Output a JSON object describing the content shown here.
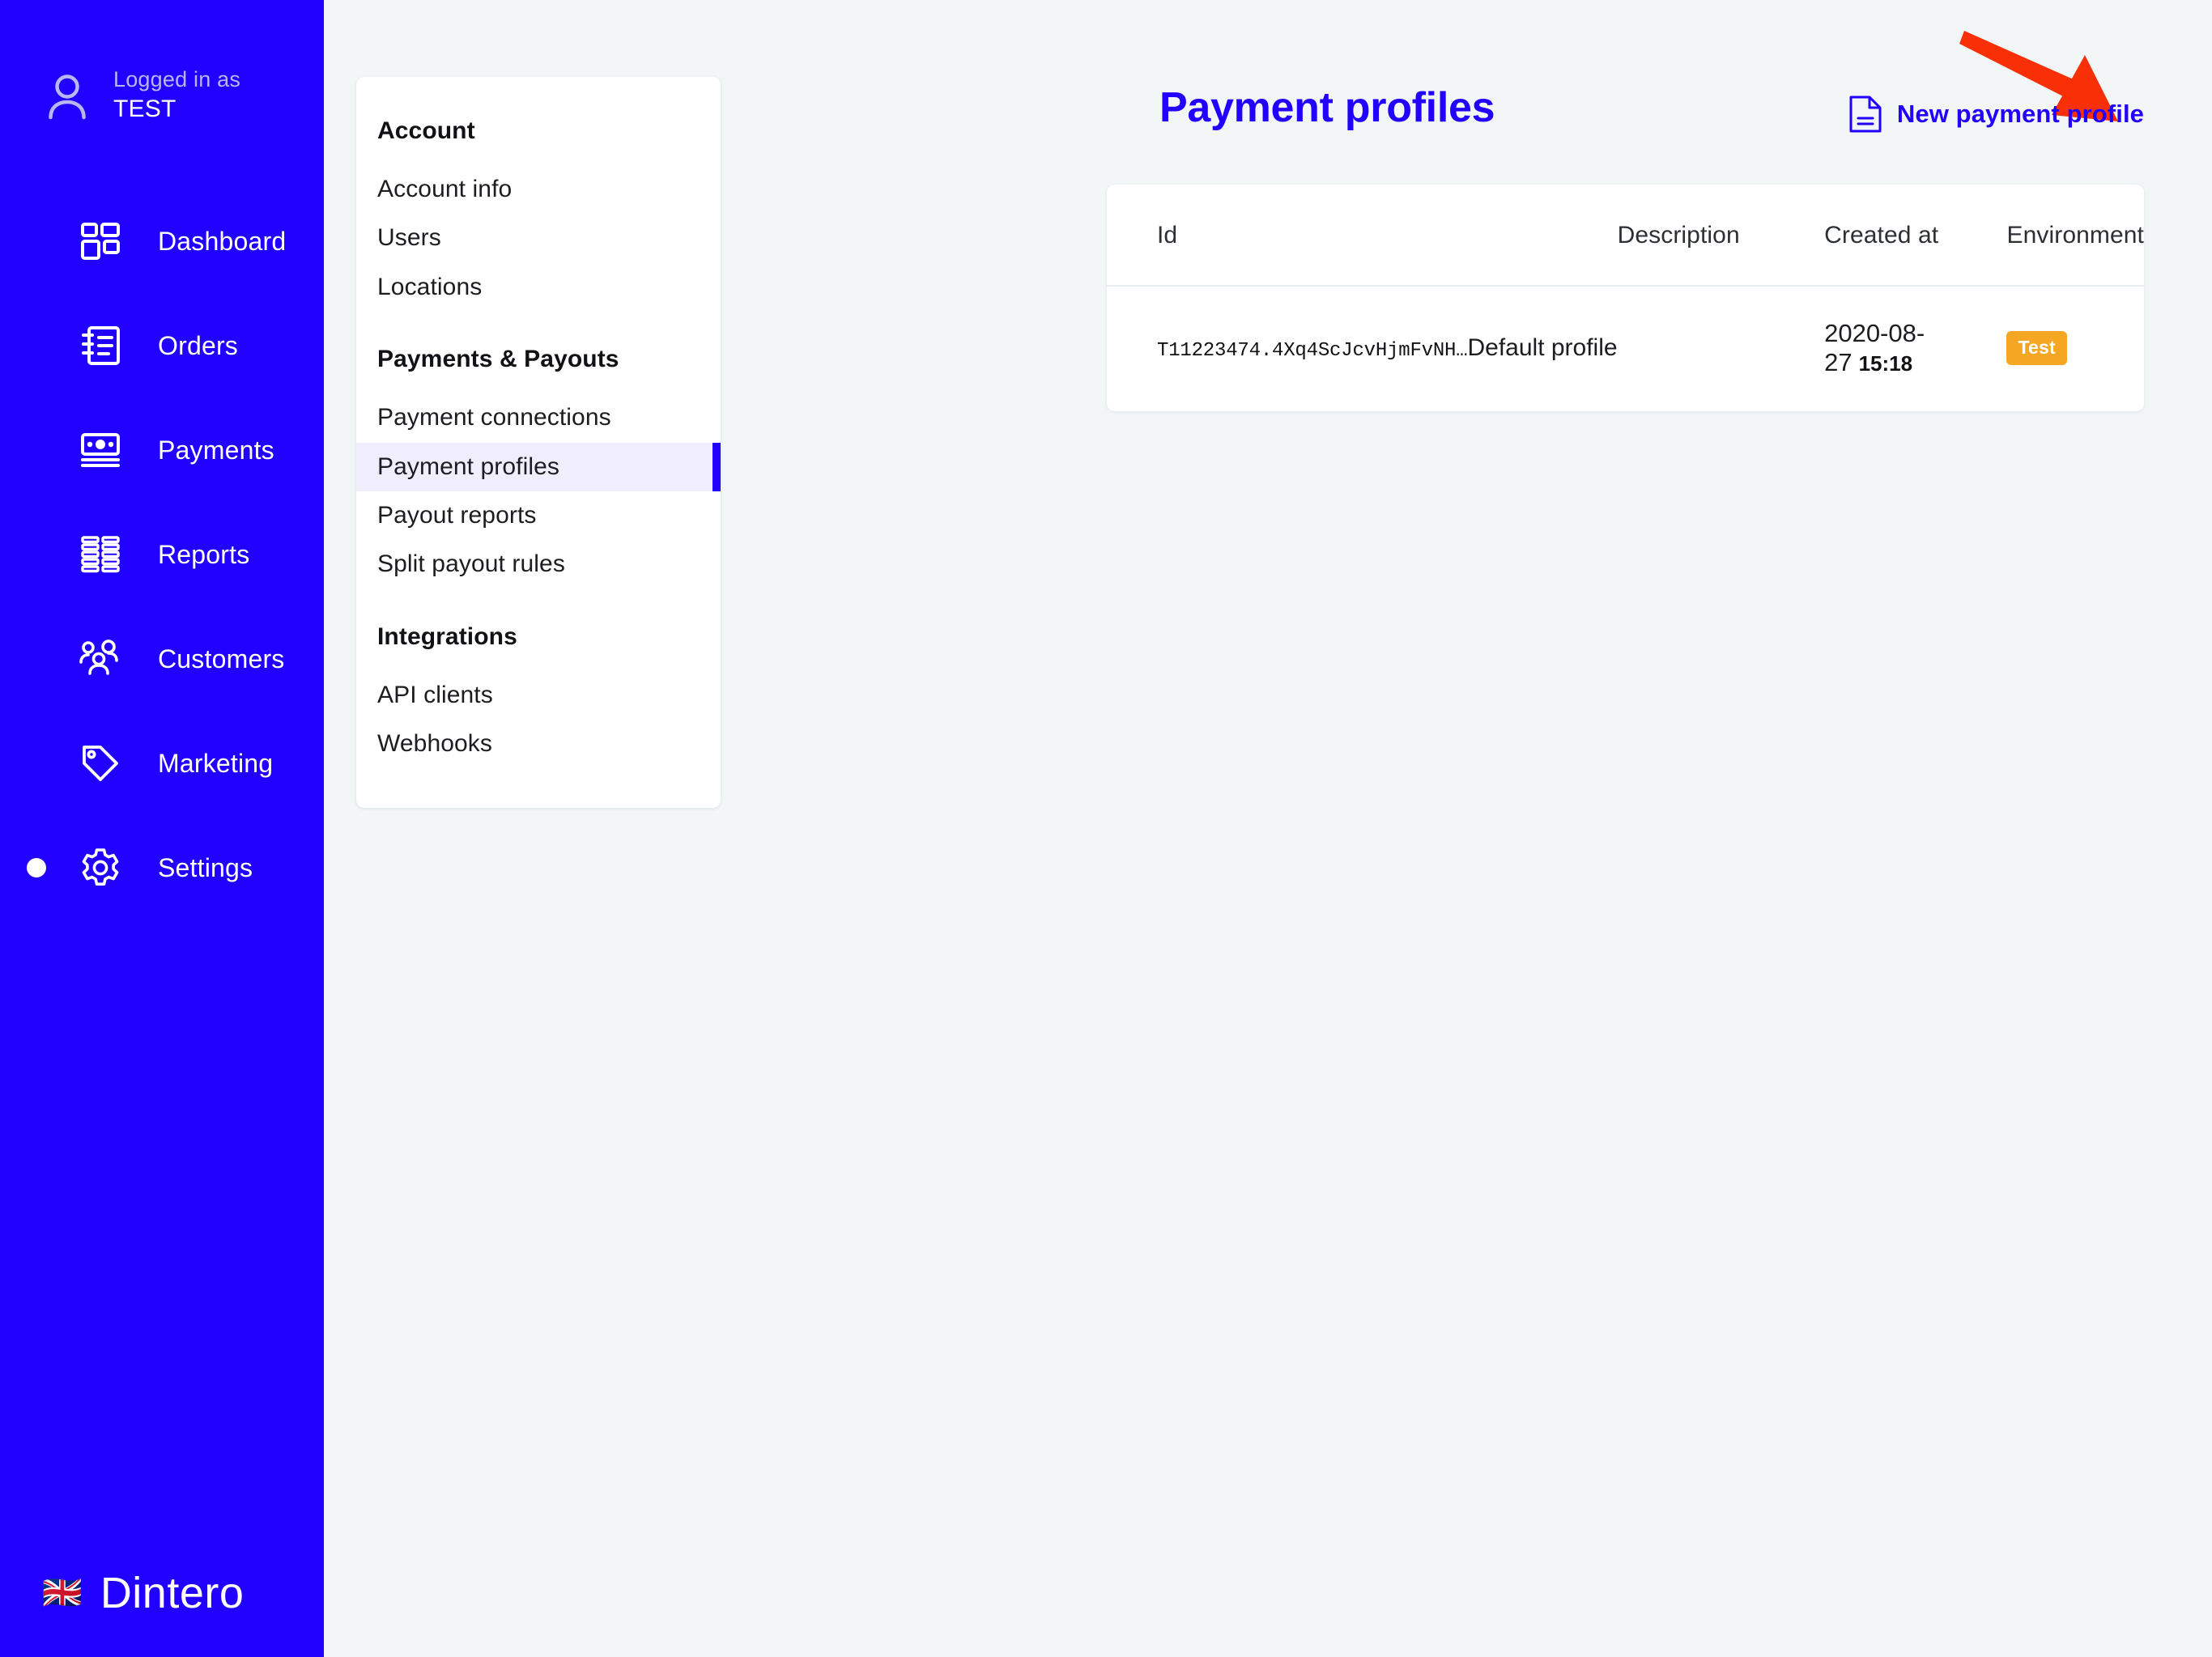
{
  "colors": {
    "brand_blue": "#2200ff",
    "page_background": "#f2f6f7",
    "active_submenu_background": "#f0eefc",
    "badge_orange": "#f5a623",
    "annotation_red": "#f93007"
  },
  "sidebar": {
    "user": {
      "logged_in_label": "Logged in as",
      "account_name": "TEST",
      "avatar_icon": "user-avatar-icon"
    },
    "nav_items": [
      {
        "label": "Dashboard",
        "icon": "dashboard-grid-icon",
        "active": false
      },
      {
        "label": "Orders",
        "icon": "orders-notebook-icon",
        "active": false
      },
      {
        "label": "Payments",
        "icon": "payments-banknote-icon",
        "active": false
      },
      {
        "label": "Reports",
        "icon": "reports-bars-icon",
        "active": false
      },
      {
        "label": "Customers",
        "icon": "customers-people-icon",
        "active": false
      },
      {
        "label": "Marketing",
        "icon": "marketing-tag-icon",
        "active": false
      },
      {
        "label": "Settings",
        "icon": "settings-gear-icon",
        "active": true
      }
    ],
    "brand": {
      "flag": "🇬🇧",
      "name": "Dintero"
    }
  },
  "submenu": {
    "groups": [
      {
        "title": "Account",
        "items": [
          {
            "label": "Account info",
            "active": false
          },
          {
            "label": "Users",
            "active": false
          },
          {
            "label": "Locations",
            "active": false
          }
        ]
      },
      {
        "title": "Payments & Payouts",
        "items": [
          {
            "label": "Payment connections",
            "active": false
          },
          {
            "label": "Payment profiles",
            "active": true
          },
          {
            "label": "Payout reports",
            "active": false
          },
          {
            "label": "Split payout rules",
            "active": false
          }
        ]
      },
      {
        "title": "Integrations",
        "items": [
          {
            "label": "API clients",
            "active": false
          },
          {
            "label": "Webhooks",
            "active": false
          }
        ]
      }
    ]
  },
  "main": {
    "page_title": "Payment profiles",
    "new_profile_action": {
      "label": "New payment profile",
      "icon": "new-document-icon"
    },
    "annotation": {
      "type": "arrow",
      "points_to": "New payment profile",
      "color": "#f93007"
    },
    "table": {
      "columns": [
        "Id",
        "Description",
        "Created at",
        "Environment"
      ],
      "rows": [
        {
          "id": "T11223474.4Xq4ScJcvHjmFvNH…",
          "description": "Default profile",
          "created_date": "2020-08-27",
          "created_time": "15:18",
          "environment": "Test"
        }
      ]
    }
  }
}
